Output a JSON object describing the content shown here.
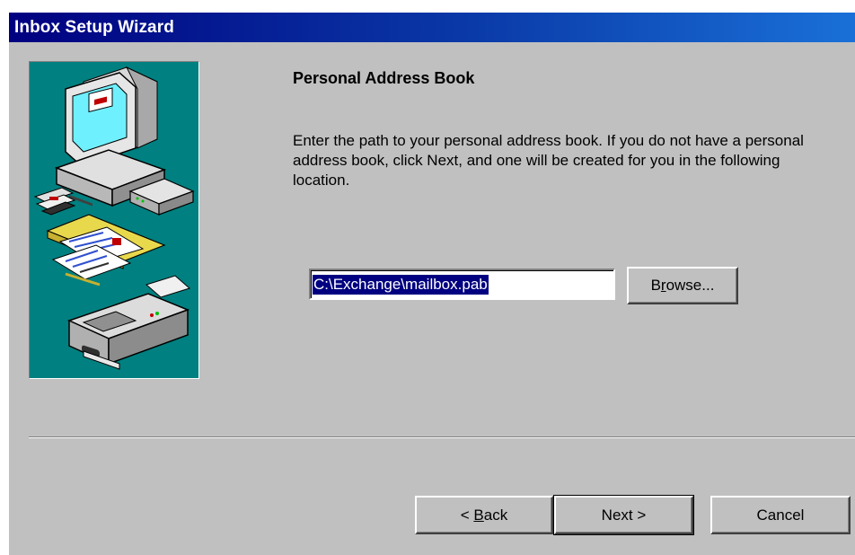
{
  "window": {
    "title": "Inbox Setup Wizard"
  },
  "page": {
    "heading": "Personal Address Book",
    "description": "Enter the path to your personal address book. If you do not have a personal address book, click Next, and one will be created for you in the following location."
  },
  "path_field": {
    "value": "C:\\Exchange\\mailbox.pab"
  },
  "buttons": {
    "browse_pre": "B",
    "browse_accel": "r",
    "browse_post": "owse...",
    "back_arrow": "<",
    "back_accel": "B",
    "back_post": "ack",
    "next_label": "Next",
    "next_arrow": ">",
    "cancel_label": "Cancel"
  },
  "colors": {
    "title_gradient_start": "#000080",
    "title_gradient_end": "#1a70d8",
    "dialog_face": "#c0c0c0",
    "illustration_bg": "#008080",
    "selection_bg": "#000080"
  },
  "illustration": {
    "icons": [
      "computer-monitor-icon",
      "floppy-disks-icon",
      "modem-icon",
      "folders-icon",
      "fax-machine-icon"
    ]
  }
}
